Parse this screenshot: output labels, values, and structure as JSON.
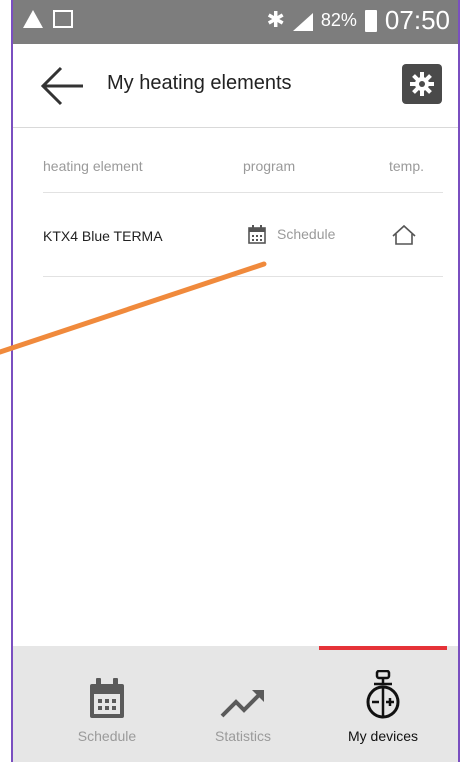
{
  "status_bar": {
    "battery_percent": "82%",
    "time": "07:50",
    "icons": [
      "warning-icon",
      "image-icon",
      "bluetooth-icon",
      "signal-icon",
      "battery-icon"
    ]
  },
  "header": {
    "title": "My heating elements",
    "back_icon": "arrow-left-icon",
    "settings_icon": "gear-icon"
  },
  "table": {
    "columns": [
      "heating element",
      "program",
      "temp."
    ],
    "rows": [
      {
        "name": "KTX4 Blue TERMA",
        "program": "Schedule",
        "program_icon": "calendar-icon",
        "temp_icon": "home-outline-icon"
      }
    ]
  },
  "bottom_nav": {
    "items": [
      {
        "label": "Schedule",
        "icon": "calendar-icon",
        "active": false
      },
      {
        "label": "Statistics",
        "icon": "trend-up-icon",
        "active": false
      },
      {
        "label": "My devices",
        "icon": "device-thermostat-icon",
        "active": true
      }
    ],
    "accent": "#e53238"
  },
  "colors": {
    "status_bar": "#7d7d7d",
    "frame": "#7a4fc0",
    "annotation": "#f08a3c"
  }
}
